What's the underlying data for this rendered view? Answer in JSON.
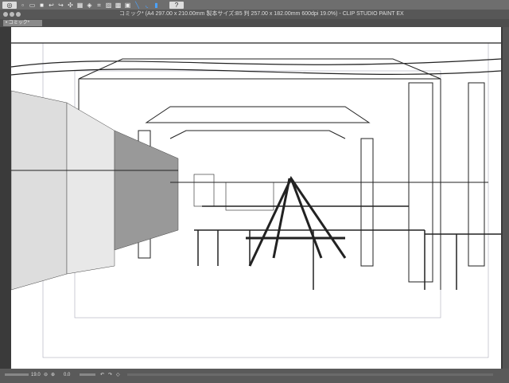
{
  "toolbar": {
    "icons": [
      "clip-studio-icon",
      "new-icon",
      "open-icon",
      "save-icon",
      "undo-icon",
      "redo-icon",
      "transform-icon",
      "fill-icon",
      "erase-icon",
      "crop-icon",
      "clear-icon",
      "clear-outside-icon",
      "fill-selection-icon",
      "snap-ruler-icon",
      "snap-special-icon",
      "snap-grid-icon",
      "help-icon"
    ]
  },
  "window": {
    "title": "コミック* (A4 297.00 x 210.00mm 製本サイズ:B5 判 257.00 x 182.00mm 600dpi 19.0%) - CLIP STUDIO PAINT EX"
  },
  "tabs": [
    {
      "label": "コミック*"
    }
  ],
  "status": {
    "zoom": "19.0",
    "angle": "0.0"
  },
  "colors": {
    "accent": "#4aa3ff"
  }
}
